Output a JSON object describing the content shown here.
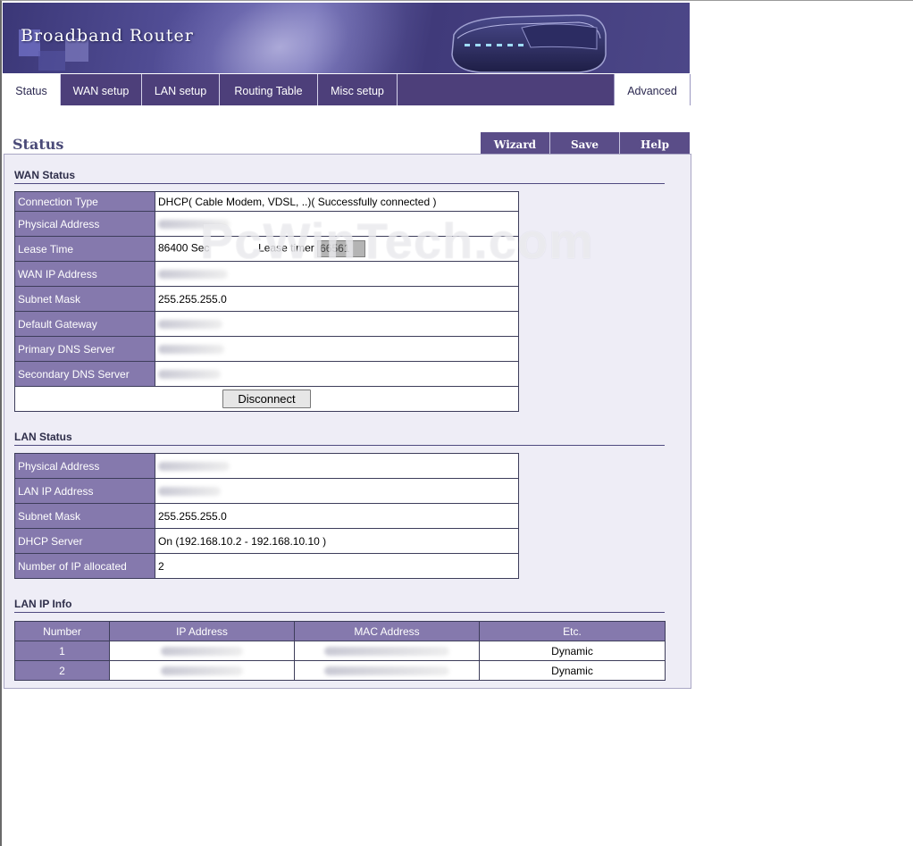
{
  "banner": {
    "brand": "Broadband Router"
  },
  "tabs": [
    {
      "label": "Status"
    },
    {
      "label": "WAN setup"
    },
    {
      "label": "LAN setup"
    },
    {
      "label": "Routing Table"
    },
    {
      "label": "Misc setup"
    }
  ],
  "advanced_label": "Advanced",
  "page_title": "Status",
  "buttons": {
    "wizard": "Wizard",
    "save": "Save",
    "help": "Help",
    "disconnect": "Disconnect"
  },
  "wan": {
    "title": "WAN Status",
    "connection_type_label": "Connection Type",
    "connection_type_value": "DHCP( Cable Modem, VDSL, ..)( Successfully connected )",
    "physical_address_label": "Physical Address",
    "lease_time_label": "Lease Time",
    "lease_time_value": "86400 Sec",
    "lease_timer_label": "Lease timer",
    "lease_timer_value": "66561",
    "wan_ip_label": "WAN IP Address",
    "subnet_mask_label": "Subnet Mask",
    "subnet_mask_value": "255.255.255.0",
    "gateway_label": "Default Gateway",
    "primary_dns_label": "Primary DNS Server",
    "secondary_dns_label": "Secondary DNS Server"
  },
  "lan": {
    "title": "LAN Status",
    "physical_address_label": "Physical Address",
    "lan_ip_label": "LAN IP Address",
    "subnet_mask_label": "Subnet Mask",
    "subnet_mask_value": "255.255.255.0",
    "dhcp_label": "DHCP Server",
    "dhcp_value": "On (192.168.10.2 - 192.168.10.10 )",
    "ip_allocated_label": "Number of IP allocated",
    "ip_allocated_value": "2"
  },
  "lan_ip_info": {
    "title": "LAN IP Info",
    "headers": [
      "Number",
      "IP Address",
      "MAC Address",
      "Etc."
    ],
    "rows": [
      {
        "number": "1",
        "etc": "Dynamic"
      },
      {
        "number": "2",
        "etc": "Dynamic"
      }
    ]
  },
  "watermark": "PcWinTech.com"
}
